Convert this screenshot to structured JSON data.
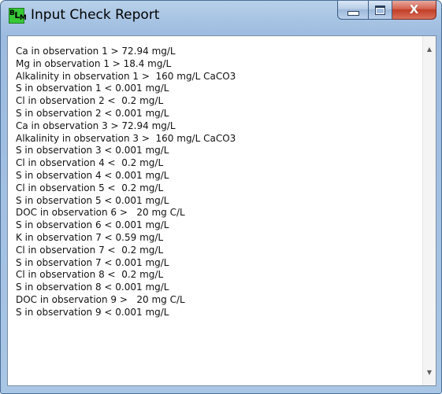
{
  "window": {
    "title": "Input Check Report",
    "icon_name": "blm-app-icon",
    "icon_text": {
      "b": "B",
      "l": "L",
      "m": "M"
    }
  },
  "caption_buttons": {
    "minimize_icon": "minimize-icon",
    "maximize_icon": "maximize-icon",
    "close_icon": "close-icon",
    "close_label": "X"
  },
  "report": {
    "lines": [
      "Ca in observation 1 > 72.94 mg/L",
      "Mg in observation 1 > 18.4 mg/L",
      "Alkalinity in observation 1 >  160 mg/L CaCO3",
      "S in observation 1 < 0.001 mg/L",
      "Cl in observation 2 <  0.2 mg/L",
      "S in observation 2 < 0.001 mg/L",
      "Ca in observation 3 > 72.94 mg/L",
      "Alkalinity in observation 3 >  160 mg/L CaCO3",
      "S in observation 3 < 0.001 mg/L",
      "Cl in observation 4 <  0.2 mg/L",
      "S in observation 4 < 0.001 mg/L",
      "Cl in observation 5 <  0.2 mg/L",
      "S in observation 5 < 0.001 mg/L",
      "DOC in observation 6 >   20 mg C/L",
      "S in observation 6 < 0.001 mg/L",
      "K in observation 7 < 0.59 mg/L",
      "Cl in observation 7 <  0.2 mg/L",
      "S in observation 7 < 0.001 mg/L",
      "Cl in observation 8 <  0.2 mg/L",
      "S in observation 8 < 0.001 mg/L",
      "DOC in observation 9 >   20 mg C/L",
      "S in observation 9 < 0.001 mg/L"
    ]
  },
  "scrollbar": {
    "up_icon": "scroll-up-arrow-icon",
    "down_icon": "scroll-down-arrow-icon",
    "up_glyph": "▲",
    "down_glyph": "▼"
  },
  "colors": {
    "title_bar": "#a9c5e4",
    "close_button": "#c23d26",
    "app_icon": "#38c838"
  }
}
